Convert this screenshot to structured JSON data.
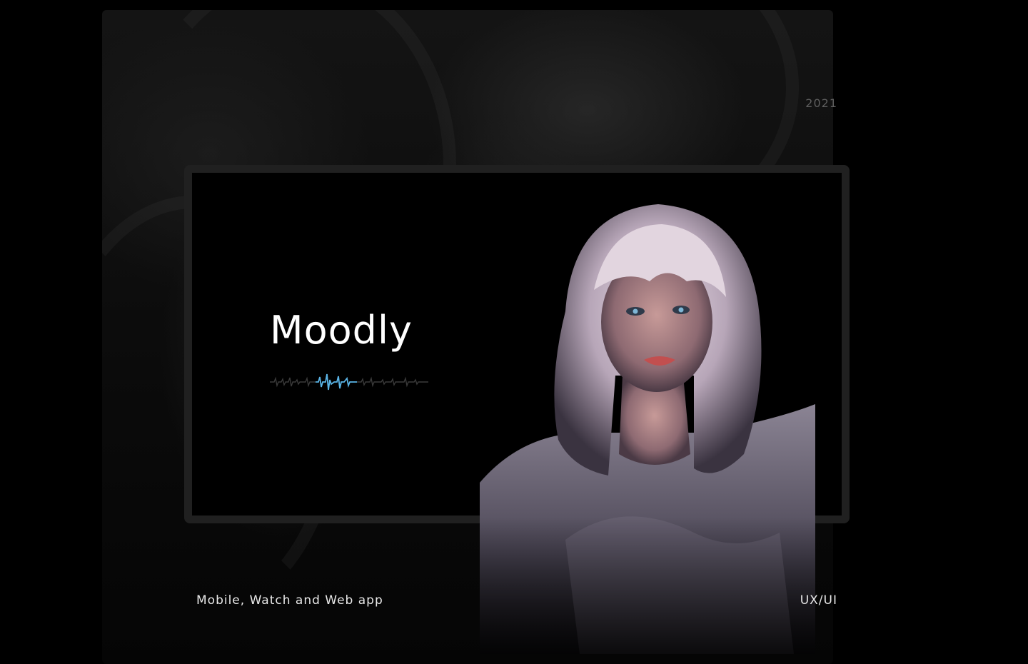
{
  "header": {
    "year": "2021"
  },
  "hero": {
    "brand_name": "Moodly",
    "wave_icon": "heartbeat-waveform-icon",
    "accent_color": "#5ab4e6"
  },
  "footer": {
    "platforms": "Mobile, Watch and Web app",
    "discipline": "UX/UI"
  },
  "colors": {
    "background": "#000000",
    "frame_border": "#202020",
    "muted_text": "#5e5e5e",
    "text": "#ffffff"
  }
}
